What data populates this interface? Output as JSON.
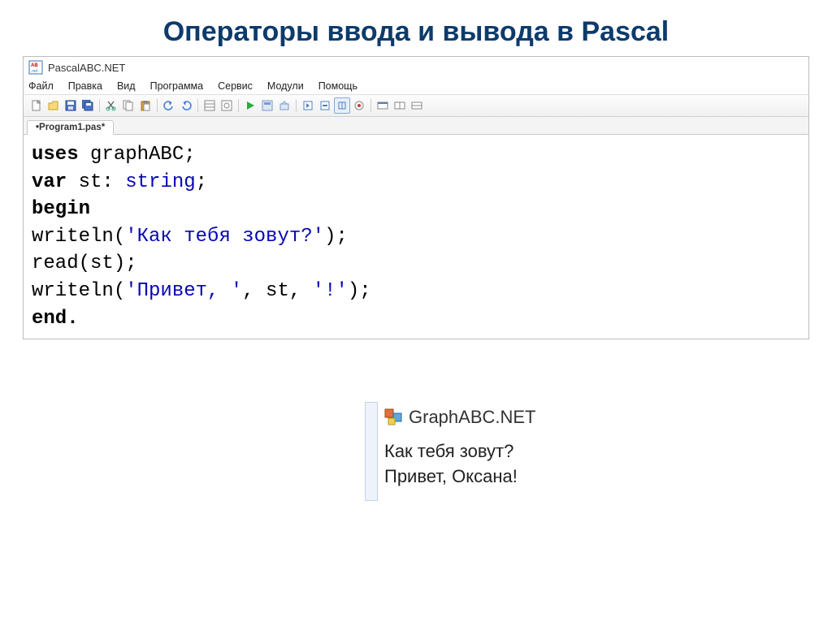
{
  "slide": {
    "title": "Операторы ввода и вывода в Pascal"
  },
  "ide": {
    "app_title": "PascalABC.NET",
    "menu": {
      "file": "Файл",
      "edit": "Правка",
      "view": "Вид",
      "program": "Программа",
      "service": "Сервис",
      "modules": "Модули",
      "help": "Помощь"
    },
    "tab": "•Program1.pas*",
    "code": {
      "l1_uses": "uses",
      "l1_mod": " graphABC",
      "l1_end": ";",
      "l2_var": "var",
      "l2_name": " st: ",
      "l2_type": "string",
      "l2_end": ";",
      "l3": "begin",
      "l4_fn": "writeln(",
      "l4_str": "'Как тебя зовут?'",
      "l4_end": ");",
      "l5": "read(st);",
      "l6_fn": "writeln(",
      "l6_s1": "'Привет, '",
      "l6_c1": ", st, ",
      "l6_s2": "'!'",
      "l6_end": ");",
      "l7": "end."
    }
  },
  "output": {
    "title": "GraphABC.NET",
    "line1": "Как тебя зовут?",
    "line2": "Привет, Оксана!"
  }
}
